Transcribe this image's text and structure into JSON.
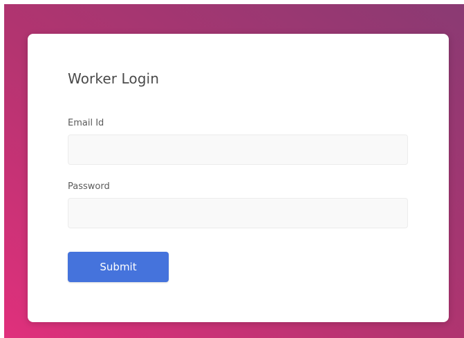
{
  "login": {
    "title": "Worker Login",
    "email_label": "Email Id",
    "email_value": "",
    "email_placeholder": "",
    "password_label": "Password",
    "password_value": "",
    "password_placeholder": "",
    "submit_label": "Submit"
  },
  "colors": {
    "gradient_start": "#e0307c",
    "gradient_end": "#8a3a73",
    "button": "#4573dc",
    "card": "#ffffff"
  }
}
